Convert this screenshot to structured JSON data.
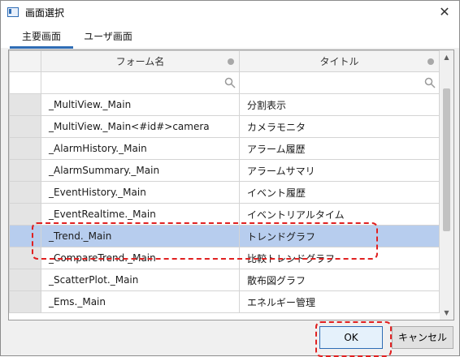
{
  "window": {
    "title": "画面選択",
    "close_label": "✕"
  },
  "tabs": [
    {
      "label": "主要画面",
      "active": true
    },
    {
      "label": "ユーザ画面",
      "active": false
    }
  ],
  "grid": {
    "columns": [
      "フォーム名",
      "タイトル"
    ],
    "rows": [
      {
        "form": "_MultiView._Main",
        "title": "分割表示"
      },
      {
        "form": "_MultiView._Main<#id#>camera",
        "title": "カメラモニタ"
      },
      {
        "form": "_AlarmHistory._Main",
        "title": "アラーム履歴"
      },
      {
        "form": "_AlarmSummary._Main",
        "title": "アラームサマリ"
      },
      {
        "form": "_EventHistory._Main",
        "title": "イベント履歴"
      },
      {
        "form": "_EventRealtime._Main",
        "title": "イベントリアルタイム"
      },
      {
        "form": "_Trend._Main",
        "title": "トレンドグラフ"
      },
      {
        "form": "_CompareTrend._Main",
        "title": "比較トレンドグラフ"
      },
      {
        "form": "_ScatterPlot._Main",
        "title": "散布図グラフ"
      },
      {
        "form": "_Ems._Main",
        "title": "エネルギー管理"
      }
    ],
    "selected_index": 6
  },
  "buttons": {
    "ok_label": "OK",
    "cancel_label": "キャンセル"
  },
  "colors": {
    "selection": "#b7cdee",
    "accent": "#2f6db5",
    "annotation": "#e02020"
  }
}
